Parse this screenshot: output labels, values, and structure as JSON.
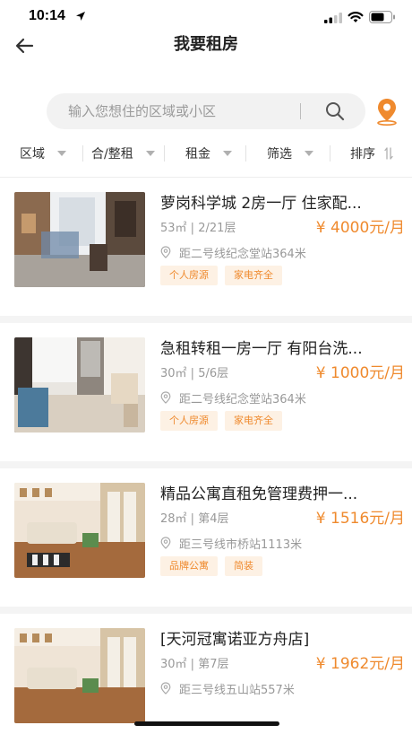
{
  "status_bar": {
    "time": "10:14"
  },
  "nav": {
    "title": "我要租房"
  },
  "search": {
    "placeholder": "输入您想住的区域或小区"
  },
  "filters": [
    {
      "label": "区域"
    },
    {
      "label": "合/整租"
    },
    {
      "label": "租金"
    },
    {
      "label": "筛选"
    },
    {
      "label": "排序"
    }
  ],
  "listings": [
    {
      "title": "萝岗科学城 2房一厅 住家配...",
      "area": "53㎡",
      "floor": "2/21层",
      "price": "¥ 4000元/月",
      "location": "距二号线纪念堂站364米",
      "tags": [
        "个人房源",
        "家电齐全"
      ]
    },
    {
      "title": "急租转租一房一厅 有阳台洗...",
      "area": "30㎡",
      "floor": "5/6层",
      "price": "¥ 1000元/月",
      "location": "距二号线纪念堂站364米",
      "tags": [
        "个人房源",
        "家电齐全"
      ]
    },
    {
      "title": "精品公寓直租免管理费押一...",
      "area": "28㎡",
      "floor": "第4层",
      "price": "¥ 1516元/月",
      "location": "距三号线市桥站1113米",
      "tags": [
        "品牌公寓",
        "简装"
      ]
    },
    {
      "title": "[天河冠寓诺亚方舟店]",
      "area": "30㎡",
      "floor": "第7层",
      "price": "¥ 1962元/月",
      "location": "距三号线五山站557米",
      "tags": []
    }
  ],
  "colors": {
    "accent": "#ef8a2e",
    "tag_bg": "#fdf1e4"
  }
}
